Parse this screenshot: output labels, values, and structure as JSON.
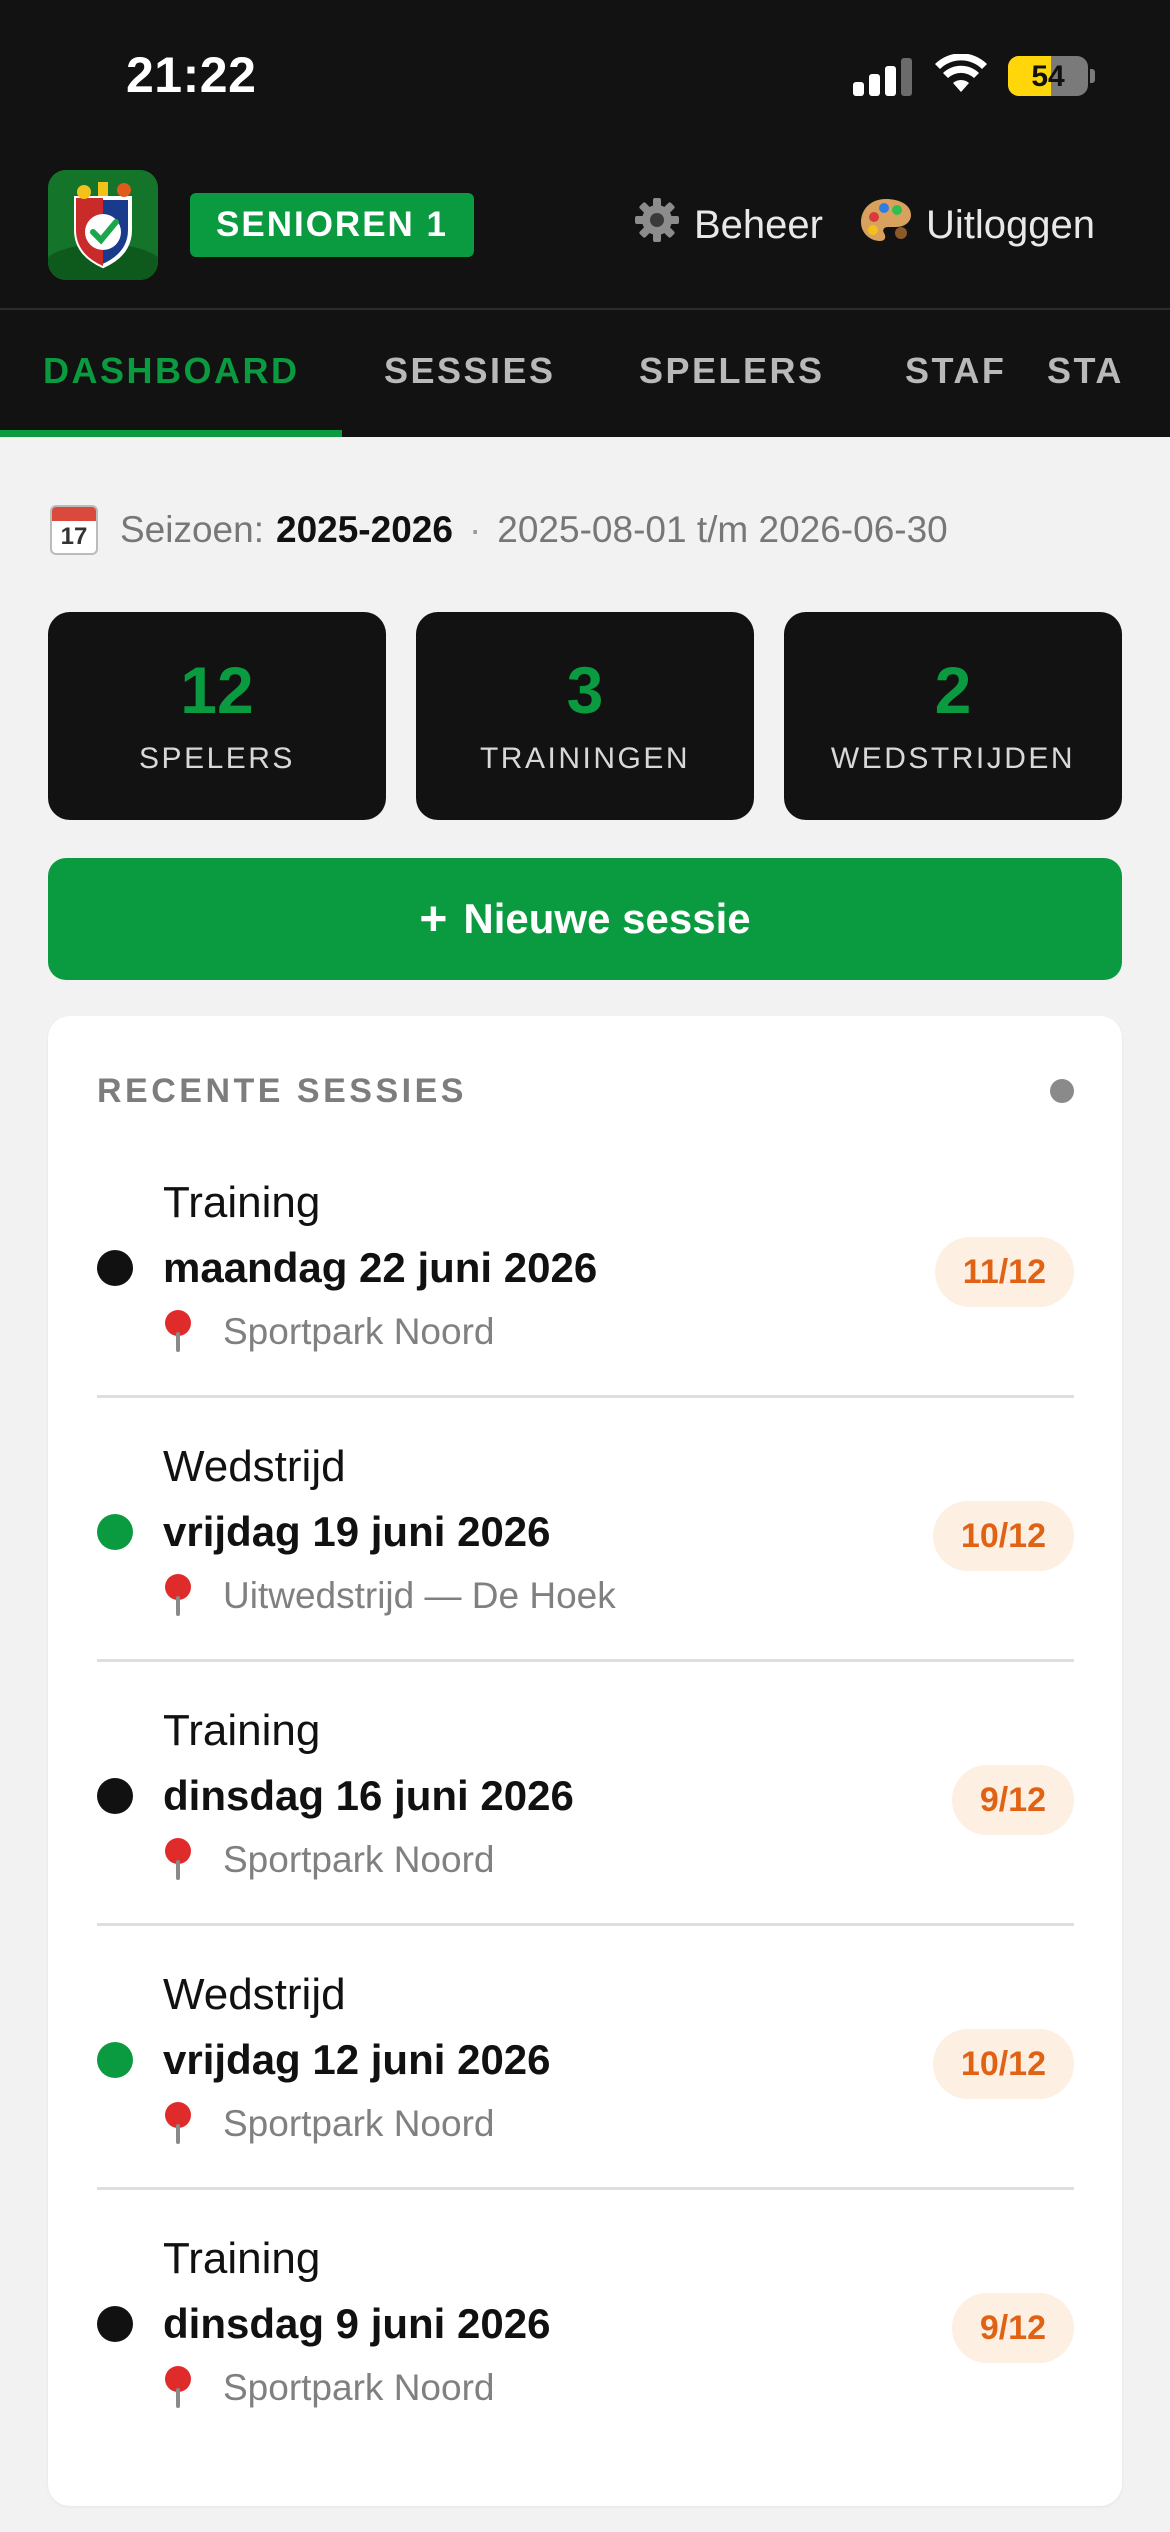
{
  "status_bar": {
    "time": "21:22",
    "battery": "54",
    "battery_level": 0.54
  },
  "header": {
    "team": "SENIOREN 1",
    "beheer_label": "Beheer",
    "uitloggen_label": "Uitloggen",
    "icons": {
      "beheer": "gear-icon",
      "uitloggen": "palette-icon",
      "logo": "club-logo"
    }
  },
  "tabs": {
    "dashboard": "DASHBOARD",
    "sessies": "SESSIES",
    "spelers": "SPELERS",
    "staf": "STAF",
    "next": "STA"
  },
  "season": {
    "calendar_day": "17",
    "label": "Seizoen:",
    "value": "2025-2026",
    "separator": "·",
    "range": "2025-08-01 t/m 2026-06-30"
  },
  "stats": [
    {
      "value": "12",
      "label": "SPELERS"
    },
    {
      "value": "3",
      "label": "TRAININGEN"
    },
    {
      "value": "2",
      "label": "WEDSTRIJDEN"
    }
  ],
  "new_session": {
    "plus": "+",
    "label": "Nieuwe sessie"
  },
  "recent": {
    "title": "RECENTE SESSIES",
    "sessions": [
      {
        "type": "Training",
        "date": "maandag 22 juni 2026",
        "location": "Sportpark Noord",
        "attendance": "11/12",
        "bullet_color": "#111111"
      },
      {
        "type": "Wedstrijd",
        "date": "vrijdag 19 juni 2026",
        "location": "Uitwedstrijd — De Hoek",
        "attendance": "10/12",
        "bullet_color": "#0a9b40"
      },
      {
        "type": "Training",
        "date": "dinsdag 16 juni 2026",
        "location": "Sportpark Noord",
        "attendance": "9/12",
        "bullet_color": "#111111"
      },
      {
        "type": "Wedstrijd",
        "date": "vrijdag 12 juni 2026",
        "location": "Sportpark Noord",
        "attendance": "10/12",
        "bullet_color": "#0a9b40"
      },
      {
        "type": "Training",
        "date": "dinsdag 9 juni 2026",
        "location": "Sportpark Noord",
        "attendance": "9/12",
        "bullet_color": "#111111"
      }
    ]
  },
  "colors": {
    "accent": "#0a9b40",
    "dark": "#121212",
    "attendance_text": "#e06214",
    "attendance_bg": "#fdf0e2"
  }
}
